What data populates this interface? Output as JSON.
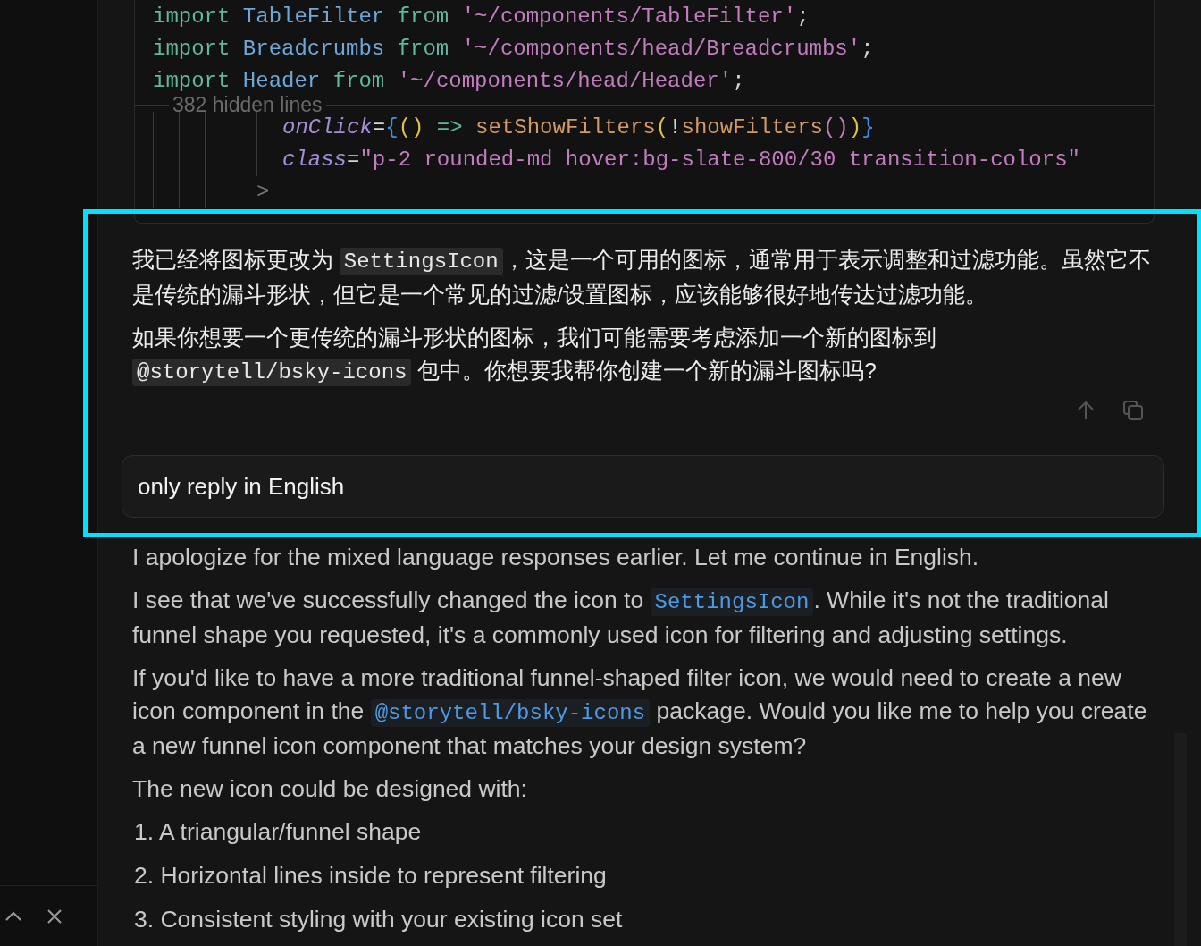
{
  "code_block": {
    "lines": [
      [
        {
          "text": "import ",
          "kind": "keyword"
        },
        {
          "text": "TableFilter ",
          "kind": "name"
        },
        {
          "text": "from ",
          "kind": "keyword"
        },
        {
          "text": "'~/components/TableFilter'",
          "kind": "string"
        },
        {
          "text": ";",
          "kind": "plain"
        }
      ],
      [
        {
          "text": "import ",
          "kind": "keyword"
        },
        {
          "text": "Breadcrumbs ",
          "kind": "name"
        },
        {
          "text": "from ",
          "kind": "keyword"
        },
        {
          "text": "'~/components/head/Breadcrumbs'",
          "kind": "string"
        },
        {
          "text": ";",
          "kind": "plain"
        }
      ],
      [
        {
          "text": "import ",
          "kind": "keyword"
        },
        {
          "text": "Header ",
          "kind": "name"
        },
        {
          "text": "from ",
          "kind": "keyword"
        },
        {
          "text": "'~/components/head/Header'",
          "kind": "string"
        },
        {
          "text": ";",
          "kind": "plain"
        }
      ]
    ],
    "hidden_lines": "382 hidden lines",
    "more_lines": [
      [
        {
          "text": "onClick",
          "kind": "attr"
        },
        {
          "text": "=",
          "kind": "plain"
        },
        {
          "text": "{",
          "kind": "brace"
        },
        {
          "text": "() ",
          "kind": "paren"
        },
        {
          "text": "=> ",
          "kind": "keyword"
        },
        {
          "text": "setShowFilters",
          "kind": "func"
        },
        {
          "text": "(",
          "kind": "paren"
        },
        {
          "text": "!",
          "kind": "plain"
        },
        {
          "text": "showFilters",
          "kind": "func"
        },
        {
          "text": "()",
          "kind": "paren2"
        },
        {
          "text": ")",
          "kind": "paren"
        },
        {
          "text": "}",
          "kind": "brace"
        }
      ],
      [
        {
          "text": "class",
          "kind": "attr"
        },
        {
          "text": "=",
          "kind": "plain"
        },
        {
          "text": "\"p-2 rounded-md hover:bg-slate-800/30 transition-colors\"",
          "kind": "string"
        }
      ],
      [
        {
          "text": ">",
          "kind": "dim"
        }
      ]
    ]
  },
  "assistant_reply_1": {
    "paragraphs": [
      [
        {
          "text": "我已经将图标更改为 ",
          "kind": "text"
        },
        {
          "text": "SettingsIcon",
          "kind": "code"
        },
        {
          "text": "，这是一个可用的图标，通常用于表示调整和过滤功能。虽然它不是传统的漏斗形状，但它是一个常见的过滤/设置图标，应该能够很好地传达过滤功能。",
          "kind": "text"
        }
      ],
      [
        {
          "text": "如果你想要一个更传统的漏斗形状的图标，我们可能需要考虑添加一个新的图标到 ",
          "kind": "text"
        },
        {
          "text": "@storytell/bsky-icons",
          "kind": "code"
        },
        {
          "text": " 包中。你想要我帮你创建一个新的漏斗图标吗?",
          "kind": "text"
        }
      ]
    ]
  },
  "user_message": {
    "text": "only reply in English"
  },
  "assistant_reply_2": {
    "paragraphs": [
      [
        {
          "text": "I apologize for the mixed language responses earlier. Let me continue in English.",
          "kind": "text"
        }
      ],
      [
        {
          "text": "I see that we've successfully changed the icon to ",
          "kind": "text"
        },
        {
          "text": "SettingsIcon",
          "kind": "code"
        },
        {
          "text": ". While it's not the traditional funnel shape you requested, it's a commonly used icon for filtering and adjusting settings.",
          "kind": "text"
        }
      ],
      [
        {
          "text": "If you'd like to have a more traditional funnel-shaped filter icon, we would need to create a new icon component in the ",
          "kind": "text"
        },
        {
          "text": "@storytell/bsky-icons",
          "kind": "code"
        },
        {
          "text": " package. Would you like me to help you create a new funnel icon component that matches your design system?",
          "kind": "text"
        }
      ],
      [
        {
          "text": "The new icon could be designed with:",
          "kind": "text"
        }
      ]
    ],
    "list_items": [
      "1. A triangular/funnel shape",
      "2. Horizontal lines inside to represent filtering",
      "3. Consistent styling with your existing icon set"
    ]
  }
}
